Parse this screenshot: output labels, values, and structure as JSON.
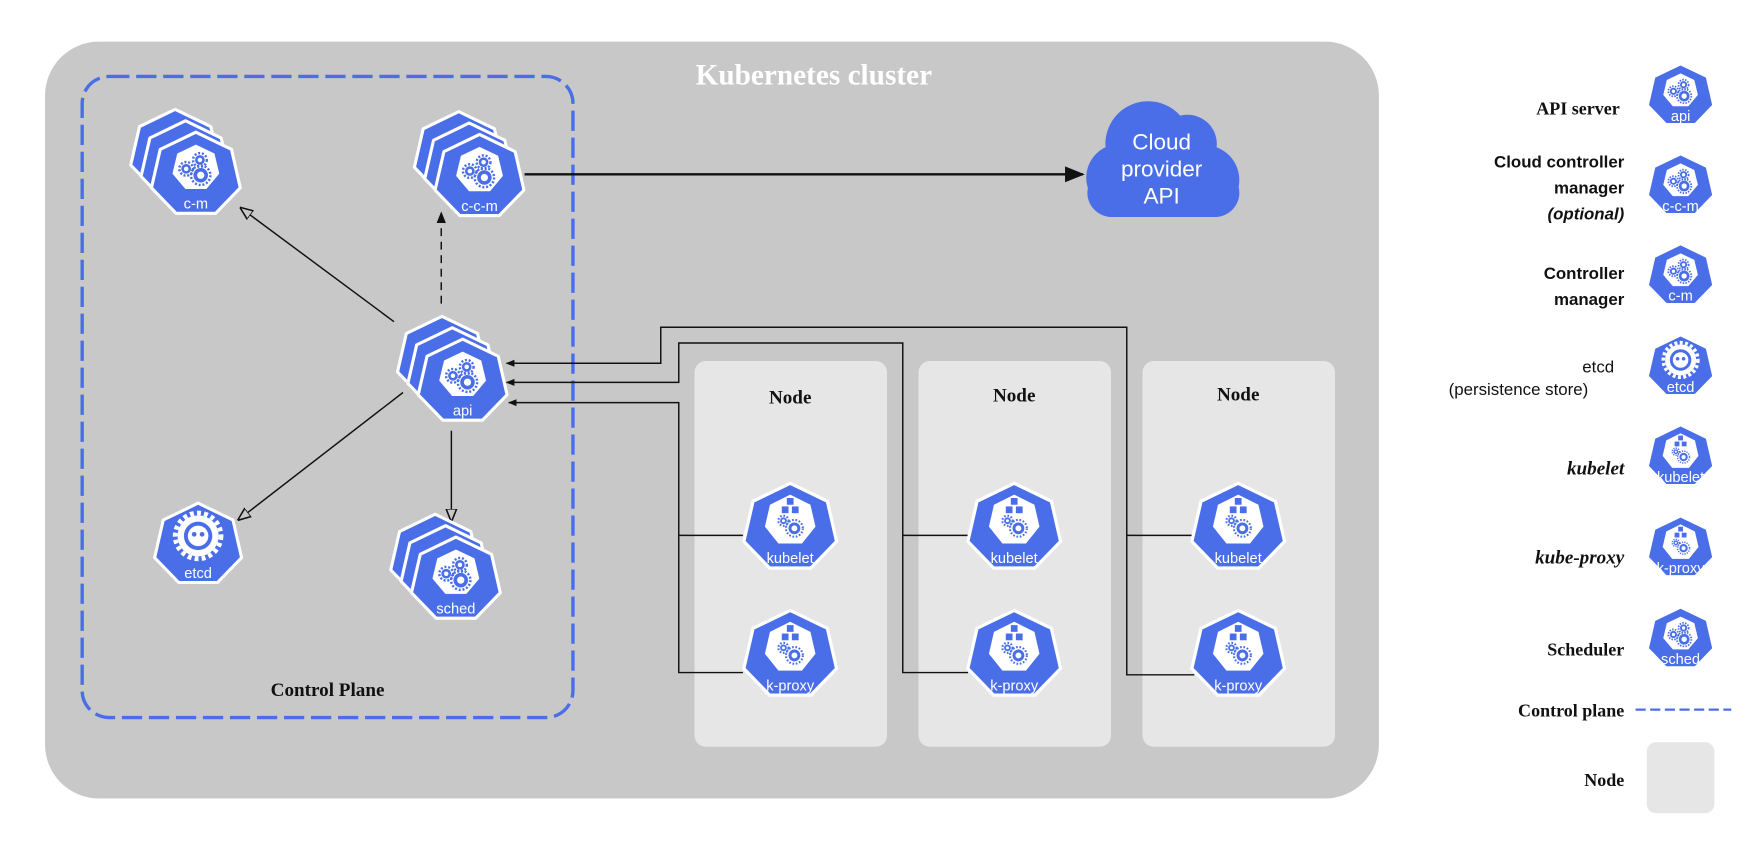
{
  "colors": {
    "icon_blue": "#4a6ee8",
    "cluster_bg": "#c8c8c8",
    "node_bg": "#e6e6e6",
    "control_plane_border": "#4a6ee8",
    "edge": "#111111",
    "white": "#ffffff"
  },
  "cluster": {
    "title": "Kubernetes cluster"
  },
  "control_plane": {
    "label": "Control Plane",
    "components": {
      "controller_manager": {
        "label": "c-m",
        "icon": "gears-icon",
        "stacked": true
      },
      "cloud_controller_manager": {
        "label": "c-c-m",
        "icon": "gears-icon",
        "stacked": true
      },
      "api_server": {
        "label": "api",
        "icon": "gears-icon",
        "stacked": true
      },
      "etcd": {
        "label": "etcd",
        "icon": "etcd-icon",
        "stacked": false
      },
      "scheduler": {
        "label": "sched",
        "icon": "gears-icon",
        "stacked": true
      }
    }
  },
  "cloud": {
    "lines": [
      "Cloud",
      "provider",
      "API"
    ]
  },
  "nodes": [
    {
      "title": "Node",
      "kubelet": "kubelet",
      "kube_proxy": "k-proxy"
    },
    {
      "title": "Node",
      "kubelet": "kubelet",
      "kube_proxy": "k-proxy"
    },
    {
      "title": "Node",
      "kubelet": "kubelet",
      "kube_proxy": "k-proxy"
    }
  ],
  "connections": [
    {
      "from": "api",
      "to": "c-m",
      "style": "solid",
      "arrow": "open"
    },
    {
      "from": "api",
      "to": "c-c-m",
      "style": "dashed",
      "arrow": "filled"
    },
    {
      "from": "api",
      "to": "etcd",
      "style": "solid",
      "arrow": "open"
    },
    {
      "from": "api",
      "to": "sched",
      "style": "solid",
      "arrow": "open"
    },
    {
      "from": "c-c-m",
      "to": "cloud-provider-api",
      "style": "solid",
      "arrow": "filled"
    },
    {
      "from": "node-1",
      "to": "api",
      "style": "solid",
      "arrow": "filled"
    },
    {
      "from": "node-2",
      "to": "api",
      "style": "solid",
      "arrow": "filled"
    },
    {
      "from": "node-3",
      "to": "api",
      "style": "solid",
      "arrow": "filled"
    }
  ],
  "legend": {
    "items": [
      {
        "key": "api_server",
        "lines": [
          "API server"
        ],
        "icon_label": "api",
        "icon": "gears-icon"
      },
      {
        "key": "cloud_controller_manager",
        "lines": [
          "Cloud controller",
          "manager",
          "(optional)"
        ],
        "icon_label": "c-c-m",
        "icon": "gears-icon"
      },
      {
        "key": "controller_manager",
        "lines": [
          "Controller",
          "manager"
        ],
        "icon_label": "c-m",
        "icon": "gears-icon"
      },
      {
        "key": "etcd",
        "lines": [
          "etcd",
          "(persistence store)"
        ],
        "icon_label": "etcd",
        "icon": "etcd-icon"
      },
      {
        "key": "kubelet",
        "lines": [
          "kubelet"
        ],
        "icon_label": "kubelet",
        "icon": "cubes-gears-icon"
      },
      {
        "key": "kube_proxy",
        "lines": [
          "kube-proxy"
        ],
        "icon_label": "k-proxy",
        "icon": "cubes-gears-icon"
      },
      {
        "key": "scheduler",
        "lines": [
          "Scheduler"
        ],
        "icon_label": "sched",
        "icon": "gears-icon"
      }
    ],
    "control_plane_label": "Control plane",
    "node_label": "Node"
  }
}
